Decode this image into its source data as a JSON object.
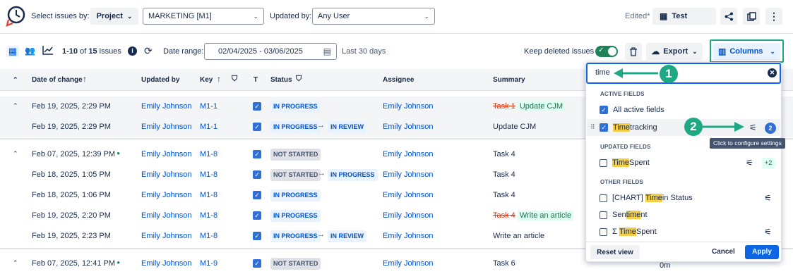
{
  "topbar": {
    "select_issues_label": "Select issues by:",
    "project_dropdown": "Project",
    "project_value": "MARKETING [M1]",
    "updated_by_label": "Updated by:",
    "updated_by_value": "Any User",
    "edited_label": "Edited*",
    "view_name": "Test"
  },
  "toolbar": {
    "count_range": "1-10",
    "of_word": "of",
    "count_total": "15",
    "issues_word": "issues",
    "date_range_label": "Date range:",
    "date_range_value": "02/04/2025 - 03/06/2025",
    "date_range_hint": "Last 30 days",
    "keep_deleted_label": "Keep deleted issues",
    "export_label": "Export",
    "columns_label": "Columns"
  },
  "table": {
    "headers": {
      "date": "Date of change",
      "updated_by": "Updated by",
      "key": "Key",
      "type": "T",
      "status": "Status",
      "assignee": "Assignee",
      "summary": "Summary"
    },
    "rows": [
      {
        "date": "Feb 19, 2025, 2:29 PM",
        "user": "Emily Johnson",
        "key": "M1-1",
        "status_from": "IN PROGRESS",
        "status_to": "",
        "assignee": "Emily Johnson",
        "summary_old": "Task 1",
        "summary_new": "Update CJM",
        "summary": ""
      },
      {
        "date": "Feb 19, 2025, 2:29 PM",
        "user": "Emily Johnson",
        "key": "M1-1",
        "status_from": "IN PROGRESS",
        "status_to": "IN REVIEW",
        "assignee": "Emily Johnson",
        "summary": "Update CJM"
      },
      {
        "date": "Feb 07, 2025, 12:39 PM",
        "user": "Emily Johnson",
        "key": "M1-8",
        "status_from": "NOT STARTED",
        "status_to": "",
        "assignee": "Emily Johnson",
        "summary": "Task 4"
      },
      {
        "date": "Feb 18, 2025, 1:05 PM",
        "user": "Emily Johnson",
        "key": "M1-8",
        "status_from": "NOT STARTED",
        "status_to": "IN PROGRESS",
        "assignee": "Emily Johnson",
        "summary": "Task 4"
      },
      {
        "date": "Feb 18, 2025, 1:06 PM",
        "user": "Emily Johnson",
        "key": "M1-8",
        "status_from": "IN PROGRESS",
        "status_to": "",
        "assignee": "Emily Johnson",
        "summary": "Task 4"
      },
      {
        "date": "Feb 19, 2025, 2:20 PM",
        "user": "Emily Johnson",
        "key": "M1-8",
        "status_from": "IN PROGRESS",
        "status_to": "",
        "assignee": "Emily Johnson",
        "summary_old": "Task 4",
        "summary_new": "Write an article",
        "summary": ""
      },
      {
        "date": "Feb 19, 2025, 2:23 PM",
        "user": "Emily Johnson",
        "key": "M1-8",
        "status_from": "IN PROGRESS",
        "status_to": "IN REVIEW",
        "assignee": "Emily Johnson",
        "summary": "Write an article"
      },
      {
        "date": "Feb 07, 2025, 12:41 PM",
        "user": "Emily Johnson",
        "key": "M1-9",
        "status_from": "NOT STARTED",
        "status_to": "",
        "assignee": "Emily Johnson",
        "summary": "Task 6",
        "extra": "0m"
      }
    ]
  },
  "columns_panel": {
    "search_value": "time",
    "active_fields_title": "ACTIVE FIELDS",
    "all_active_fields": "All active fields",
    "time_tracking_hl": "Time",
    "time_tracking_rest": " tracking",
    "time_tracking_badge": "2",
    "tooltip": "Click to configure settings",
    "updated_fields_title": "UPDATED FIELDS",
    "time_spent_hl": "Time",
    "time_spent_rest": " Spent",
    "time_spent_badge": "+2",
    "other_fields_title": "OTHER FIELDS",
    "chart_prefix": "[CHART] ",
    "chart_hl": "Time",
    "chart_rest": " in Status",
    "sentiment_pre": "Sen",
    "sentiment_hl": "time",
    "sentiment_post": "nt",
    "sigma_prefix": "Σ ",
    "sigma_hl": "Time",
    "sigma_rest": " Spent",
    "reset_view": "Reset view",
    "cancel": "Cancel",
    "apply": "Apply"
  },
  "callouts": {
    "one": "1",
    "two": "2"
  },
  "colors": {
    "accent": "#0052cc",
    "callout": "#1ea883",
    "highlight": "#f5cd47",
    "apply": "#0c66e4"
  }
}
